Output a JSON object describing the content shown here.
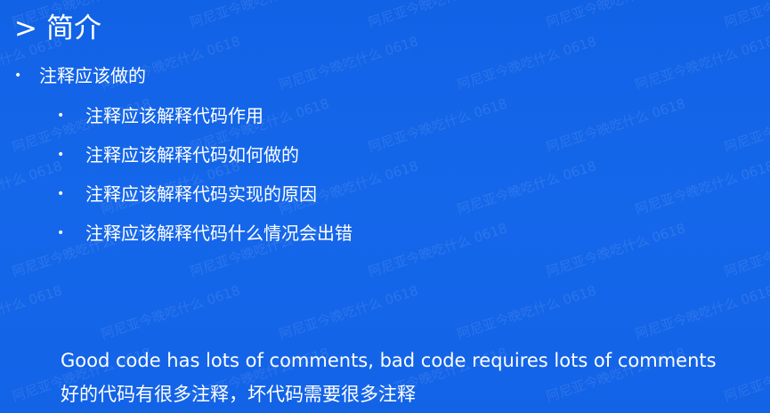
{
  "slide": {
    "title_marker": ">",
    "title": "简介",
    "main_bullet": "注释应该做的",
    "sub_bullets": [
      "注释应该解释代码作用",
      "注释应该解释代码如何做的",
      "注释应该解释代码实现的原因",
      "注释应该解释代码什么情况会出错"
    ],
    "quote_en": "Good code has lots of comments, bad code requires lots of comments",
    "quote_zh": "好的代码有很多注释，坏代码需要很多注释"
  },
  "watermark": "阿尼亚今晚吃什么 0618",
  "colors": {
    "background": "#1565e8",
    "text": "#ffffff"
  }
}
